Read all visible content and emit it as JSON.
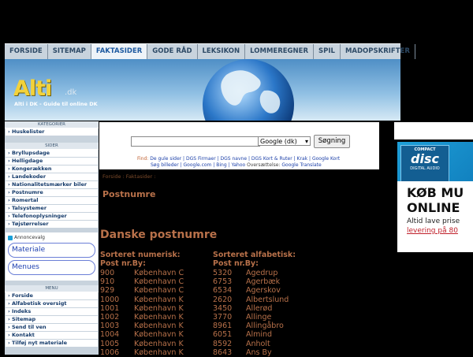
{
  "topnav": {
    "tabs": [
      {
        "label": "FORSIDE"
      },
      {
        "label": "SITEMAP"
      },
      {
        "label": "FAKTASIDER",
        "active": true
      },
      {
        "label": "GODE RÅD"
      },
      {
        "label": "LEKSIKON"
      },
      {
        "label": "LOMMEREGNER"
      },
      {
        "label": "SPIL"
      },
      {
        "label": "MADOPSKRIFTER"
      }
    ]
  },
  "banner": {
    "logo": "Alti",
    "logo_suffix": ".dk",
    "tagline": "Alti i DK - Guide til online DK"
  },
  "sidebar": {
    "kategorier_title": "KATEGORIER",
    "kategorier": [
      {
        "label": "Huskelister"
      }
    ],
    "sider_title": "SIDER",
    "sider": [
      {
        "label": "Bryllupsdage"
      },
      {
        "label": "Helligdage"
      },
      {
        "label": "Kongerækken"
      },
      {
        "label": "Landekoder"
      },
      {
        "label": "Nationalitetsmærker biler"
      },
      {
        "label": "Postnumre"
      },
      {
        "label": "Romertal"
      },
      {
        "label": "Talsystemer"
      },
      {
        "label": "Telefonoplysninger"
      },
      {
        "label": "Tøjstørrelser"
      }
    ],
    "ad": {
      "adchoices": "Annoncevalg",
      "buttons": [
        {
          "label": "Materiale"
        },
        {
          "label": "Menues"
        }
      ]
    },
    "menu_title": "MENU",
    "menu": [
      {
        "label": "Forside"
      },
      {
        "label": "Alfabetisk oversigt"
      },
      {
        "label": "Indeks"
      },
      {
        "label": "Sitemap"
      },
      {
        "label": "Send til ven"
      },
      {
        "label": "Kontakt"
      },
      {
        "label": "Tilføj nyt materiale"
      }
    ]
  },
  "search": {
    "input_value": "",
    "engine": "Google (dk)",
    "button": "Søgning",
    "find_label": "Find:",
    "links1": [
      "De gule sider",
      "DGS Firmaer",
      "DGS navne",
      "DGS Kort & Ruter",
      "Krak",
      "Google Kort"
    ],
    "links2_pre": [
      "Søg billeder",
      "Google.com",
      "Bing",
      "Yahoo"
    ],
    "oversaettelse": "Oversættelse:",
    "translate": "Google Translate"
  },
  "main": {
    "breadcrumb": "Forside : Faktasider :",
    "page_title": "Postnumre",
    "heading": "Danske postnumre",
    "col1_head1": "Sorteret numerisk:",
    "col1_head2": "Post nr.By:",
    "col2_head1": "Sorteret alfabetisk:",
    "col2_head2": "Post nr.By:",
    "numeric": [
      {
        "nr": "900",
        "by": "København C"
      },
      {
        "nr": "910",
        "by": "København C"
      },
      {
        "nr": "929",
        "by": "København C"
      },
      {
        "nr": "1000",
        "by": "København K"
      },
      {
        "nr": "1001",
        "by": "København K"
      },
      {
        "nr": "1002",
        "by": "København K"
      },
      {
        "nr": "1003",
        "by": "København K"
      },
      {
        "nr": "1004",
        "by": "København K"
      },
      {
        "nr": "1005",
        "by": "København K"
      },
      {
        "nr": "1006",
        "by": "København K"
      }
    ],
    "alpha": [
      {
        "nr": "5320",
        "by": "Agedrup"
      },
      {
        "nr": "6753",
        "by": "Agerbæk"
      },
      {
        "nr": "6534",
        "by": "Agerskov"
      },
      {
        "nr": "2620",
        "by": "Albertslund"
      },
      {
        "nr": "3450",
        "by": "Allerød"
      },
      {
        "nr": "3770",
        "by": "Allinge"
      },
      {
        "nr": "8961",
        "by": "Allingåbro"
      },
      {
        "nr": "6051",
        "by": "Almind"
      },
      {
        "nr": "8592",
        "by": "Anholt"
      },
      {
        "nr": "8643",
        "by": "Ans By"
      }
    ]
  },
  "rightad": {
    "brand_top": "COMPACT",
    "brand": "disc",
    "brand_bottom": "DIGITAL AUDIO",
    "line1": "KØB MU",
    "line2": "ONLINE",
    "line3": "Altid lave prise",
    "line4": "levering på 80"
  },
  "colors": {
    "accent_text": "#b8714a",
    "nav_bg": "#c8d3dd",
    "link": "#143a6a"
  }
}
